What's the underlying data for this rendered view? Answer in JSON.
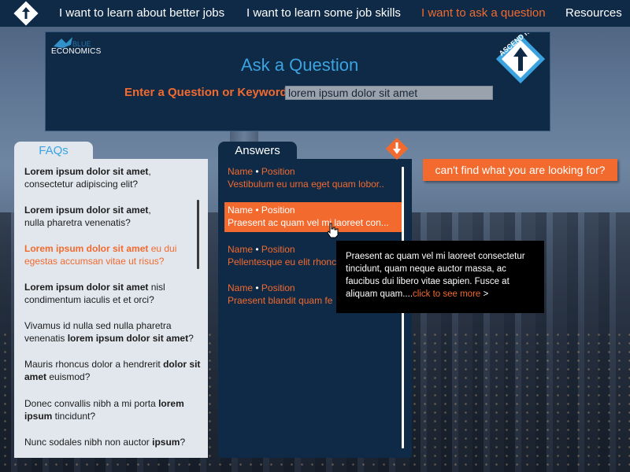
{
  "nav": {
    "logo": "ascend-nyc-logo",
    "items": [
      {
        "label": "I want to learn about better jobs",
        "active": false
      },
      {
        "label": "I want to learn some job skills",
        "active": false
      },
      {
        "label": "I want to ask a question",
        "active": true
      },
      {
        "label": "Resources",
        "active": false
      }
    ]
  },
  "header": {
    "brand_logo_text": "BLUE",
    "brand_subtext": "ECONOMICS",
    "title": "Ask a Question",
    "question_label": "Enter a Question or Keyword:",
    "question_value": "lorem ipsum dolor sit amet",
    "right_logo_text": "ASCEND NYC"
  },
  "faqs": {
    "tab_label": "FAQs",
    "items": [
      {
        "bold": "Lorem ipsum dolor sit amet",
        "text": ",\nconsectetur adipiscing elit?",
        "active": false
      },
      {
        "bold": "Lorem ipsum dolor sit amet",
        "text": ",\nnulla pharetra venenatis?",
        "active": false
      },
      {
        "bold": "Lorem ipsum dolor sit amet",
        "text": " eu dui egestas accumsan vitae ut risus?",
        "active": true
      },
      {
        "bold": "Lorem ipsum dolor sit amet",
        "text": " nisl condimentum iaculis et et orci?",
        "active": false
      },
      {
        "pre": "Vivamus id nulla sed nulla pharetra venenatis ",
        "bold": "lorem ipsum dolor sit amet",
        "text": "?",
        "active": false
      },
      {
        "pre": "Mauris rhoncus dolor a hendrerit ",
        "bold": "dolor sit amet",
        "text": " euismod?",
        "active": false
      },
      {
        "pre": "Donec convallis nibh a mi porta ",
        "bold": "lorem ipsum",
        "text": " tincidunt?",
        "active": false
      },
      {
        "pre": "Nunc sodales nibh non auctor ",
        "bold": "ipsum",
        "text": "?",
        "active": false
      }
    ]
  },
  "answers": {
    "tab_label": "Answers",
    "items": [
      {
        "name": "Name",
        "position": "Position",
        "snippet": "Vestibulum eu urna eget quam lobor..",
        "active": false
      },
      {
        "name": "Name",
        "position": "Position",
        "snippet": "Praesent ac quam vel mi laoreet con...",
        "active": true
      },
      {
        "name": "Name",
        "position": "Position",
        "snippet": "Pellentesque eu elit rhonc",
        "active": false
      },
      {
        "name": "Name",
        "position": "Position",
        "snippet": "Praesent blandit quam fe",
        "active": false
      }
    ]
  },
  "cant_find": "can't find what you are looking for?",
  "tooltip": {
    "text": "Praesent ac quam vel mi laoreet consectetur tincidunt, quam neque auctor massa, ac faucibus dui libero vitae sapien. Fusce at aliquam quam....",
    "more_label": "click to see more",
    "more_arrow": ">"
  },
  "colors": {
    "accent": "#f26a2e",
    "navy": "#0f2a47",
    "link_blue": "#3aa3e0"
  }
}
